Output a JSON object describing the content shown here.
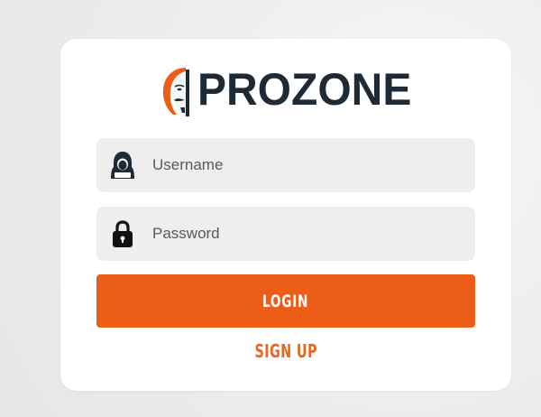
{
  "brand": {
    "name": "PROZONE",
    "logo_icon": "anonymous-mask-logo",
    "text_color": "#1e2a36",
    "accent_color": "#ec5e17"
  },
  "form": {
    "username": {
      "placeholder": "Username",
      "value": "",
      "icon": "hooded-user-icon"
    },
    "password": {
      "placeholder": "Password",
      "value": "",
      "icon": "lock-icon"
    },
    "login_label": "LOGIN",
    "signup_label": "SIGN UP"
  }
}
